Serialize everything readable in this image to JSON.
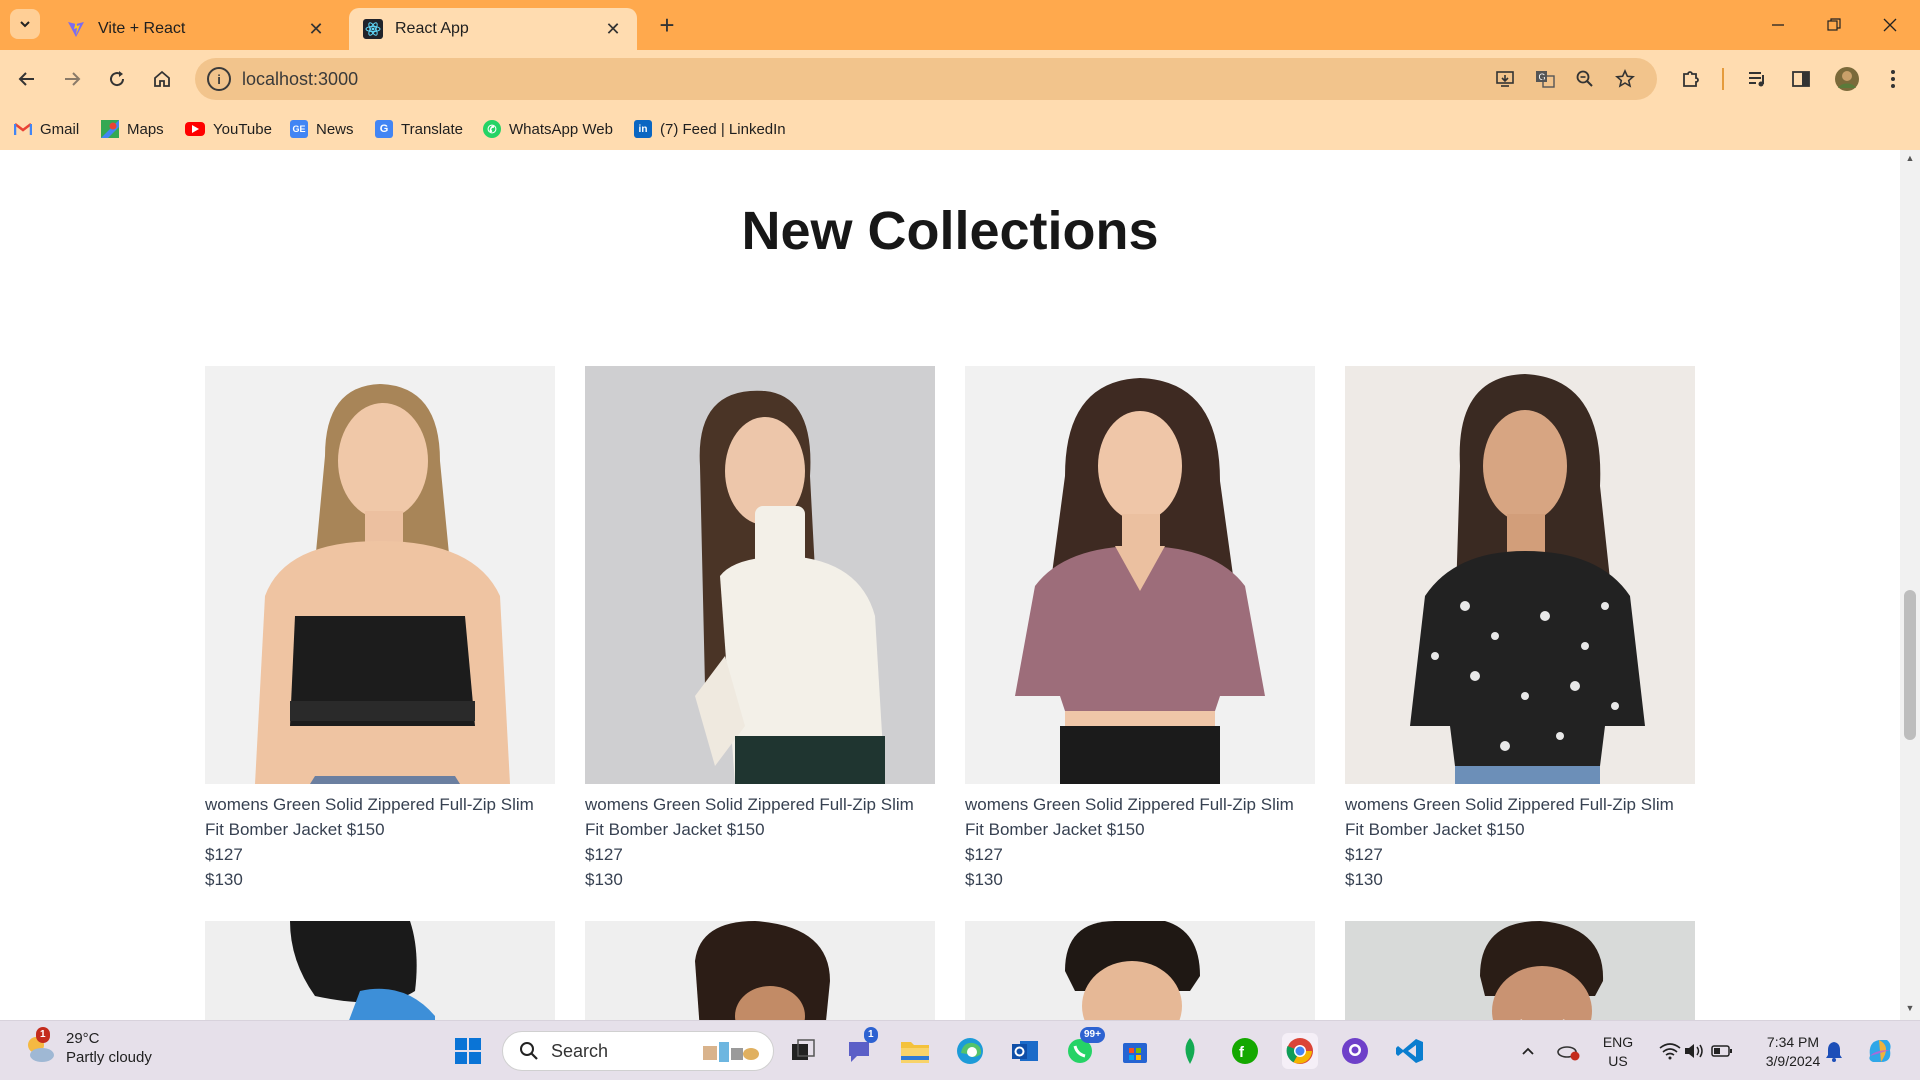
{
  "browser": {
    "tabs": [
      {
        "title": "Vite + React",
        "active": false
      },
      {
        "title": "React App",
        "active": true
      }
    ],
    "url": "localhost:3000",
    "bookmarks": [
      "Gmail",
      "Maps",
      "YouTube",
      "News",
      "Translate",
      "WhatsApp Web",
      "(7) Feed | LinkedIn"
    ]
  },
  "page": {
    "heading": "New Collections",
    "products": [
      {
        "name": "womens Green Solid Zippered Full-Zip Slim Fit Bomber Jacket $150",
        "new_price": "$127",
        "old_price": "$130"
      },
      {
        "name": "womens Green Solid Zippered Full-Zip Slim Fit Bomber Jacket $150",
        "new_price": "$127",
        "old_price": "$130"
      },
      {
        "name": "womens Green Solid Zippered Full-Zip Slim Fit Bomber Jacket $150",
        "new_price": "$127",
        "old_price": "$130"
      },
      {
        "name": "womens Green Solid Zippered Full-Zip Slim Fit Bomber Jacket $150",
        "new_price": "$127",
        "old_price": "$130"
      }
    ]
  },
  "taskbar": {
    "weather": {
      "temp": "29°C",
      "condition": "Partly cloudy",
      "badge": "1"
    },
    "search_placeholder": "Search",
    "teams_badge": "1",
    "whatsapp_badge": "99+",
    "language": {
      "lang": "ENG",
      "region": "US"
    },
    "clock": {
      "time": "7:34 PM",
      "date": "3/9/2024"
    }
  }
}
